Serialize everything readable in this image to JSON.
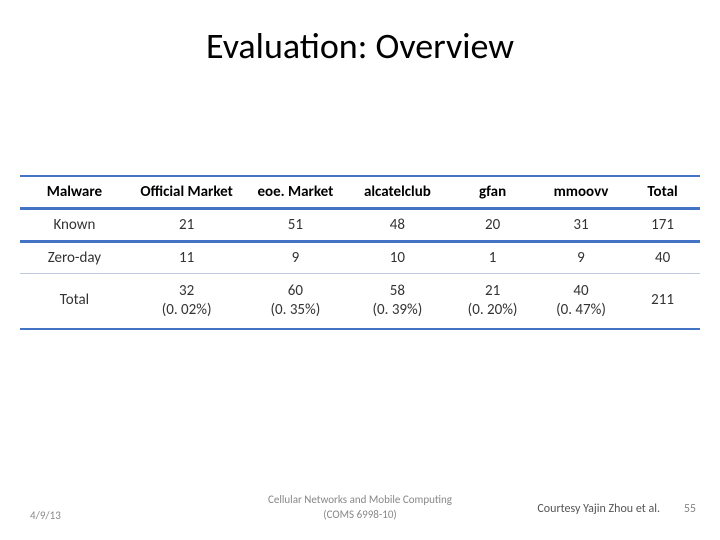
{
  "title": "Evaluation: Overview",
  "table": {
    "headers": [
      "Malware",
      "Official Market",
      "eoe. Market",
      "alcatelclub",
      "gfan",
      "mmoovv",
      "Total"
    ],
    "rows": [
      {
        "label": "Known",
        "values": [
          "21",
          "51",
          "48",
          "20",
          "31",
          "171"
        ]
      },
      {
        "label": "Zero-day",
        "values": [
          "11",
          "9",
          "10",
          "1",
          "9",
          "40"
        ]
      },
      {
        "label": "Total",
        "values": [
          {
            "n": "32",
            "pct": "(0. 02%)"
          },
          {
            "n": "60",
            "pct": "(0. 35%)"
          },
          {
            "n": "58",
            "pct": "(0. 39%)"
          },
          {
            "n": "21",
            "pct": "(0. 20%)"
          },
          {
            "n": "40",
            "pct": "(0. 47%)"
          },
          "211"
        ]
      }
    ]
  },
  "footer": {
    "date": "4/9/13",
    "center_line1": "Cellular Networks and Mobile Computing",
    "center_line2": "(COMS 6998-10)",
    "courtesy": "Courtesy Yajin Zhou et al.",
    "page": "55"
  },
  "colors": {
    "accent": "#4472c4"
  }
}
